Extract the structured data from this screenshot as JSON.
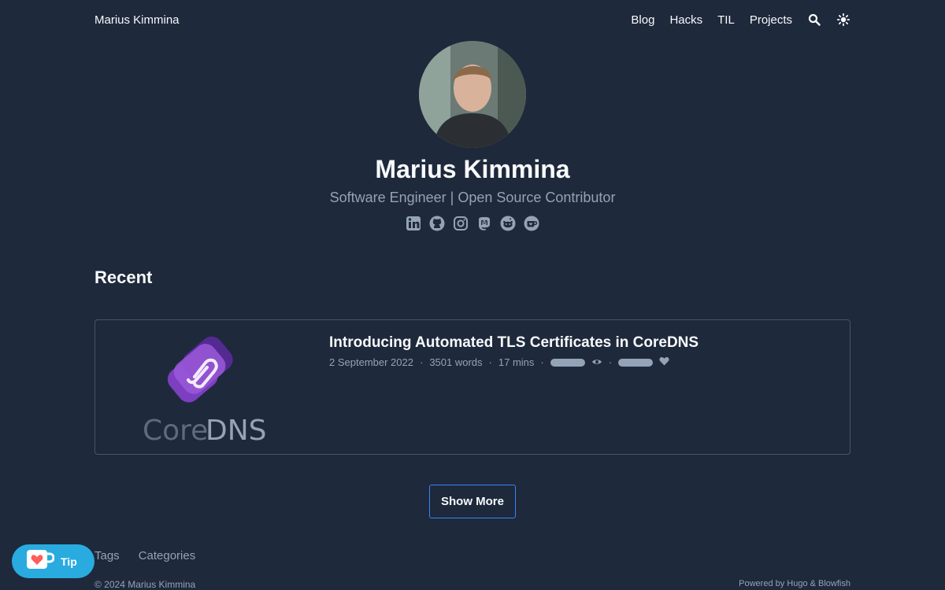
{
  "header": {
    "site_title": "Marius Kimmina",
    "nav": [
      "Blog",
      "Hacks",
      "TIL",
      "Projects"
    ],
    "icons": [
      "search-icon",
      "theme-toggle-icon"
    ]
  },
  "profile": {
    "name": "Marius Kimmina",
    "tagline": "Software Engineer | Open Source Contributor",
    "socials": [
      "linkedin-icon",
      "github-icon",
      "instagram-icon",
      "mastodon-icon",
      "reddit-icon",
      "kofi-icon"
    ]
  },
  "recent": {
    "heading": "Recent",
    "article": {
      "title": "Introducing Automated TLS Certificates in CoreDNS",
      "date": "2 September 2022",
      "words": "3501 words",
      "read_time": "17 mins",
      "separator": "·",
      "thumbnail_text_light": "Core",
      "thumbnail_text_dark": "DNS"
    }
  },
  "show_more": "Show More",
  "footer": {
    "links": [
      "Tags",
      "Categories"
    ],
    "copyright": "© 2024 Marius Kimmina",
    "powered": "Powered by Hugo & Blowfish"
  },
  "tip": {
    "label": "Tip"
  },
  "colors": {
    "background": "#1e293b",
    "accent": "#3b82f6",
    "tip": "#29abe0"
  }
}
